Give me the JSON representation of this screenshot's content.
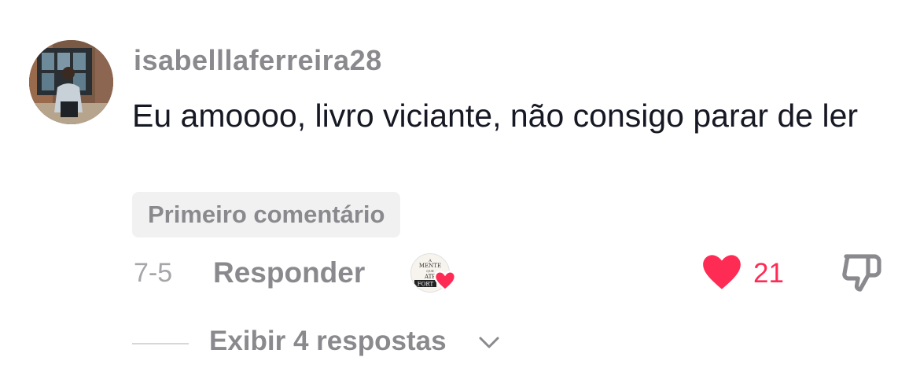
{
  "comment": {
    "username": "isabelllaferreira28",
    "text": "Eu amoooo, livro viciante, não consigo parar de ler",
    "badge": "Primeiro comentário",
    "date": "7-5",
    "reply_label": "Responder",
    "like_count": "21",
    "liked_by_creator": true,
    "creator_avatar_text": [
      "A",
      "MENTE",
      "QUE",
      "ATP",
      "FORT"
    ]
  },
  "replies": {
    "label": "Exibir 4 respostas"
  },
  "colors": {
    "like_red": "#fe2c55",
    "muted_text": "#8a8a8e",
    "body_text": "#161823"
  },
  "icons": [
    "heart-icon",
    "dislike-icon",
    "chevron-down-icon"
  ]
}
